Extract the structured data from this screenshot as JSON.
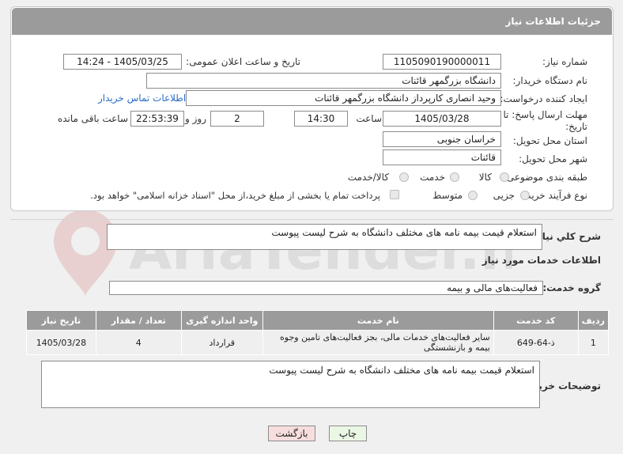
{
  "header": {
    "title": "جزئیات اطلاعات نیاز"
  },
  "form": {
    "need_number_label": "شماره نیاز:",
    "need_number": "1105090190000011",
    "announce_label": "تاریخ و ساعت اعلان عمومی:",
    "announce_value": "1405/03/25 - 14:24",
    "buyer_org_label": "نام دستگاه خریدار:",
    "buyer_org": "دانشگاه بزرگمهر قائنات",
    "creator_label": "ایجاد کننده درخواست:",
    "creator": "وحید انصاری کارپرداز دانشگاه بزرگمهر قائنات",
    "contact_link": "اطلاعات تماس خریدار",
    "deadline_label_1": "مهلت ارسال پاسخ: تا",
    "deadline_label_2": "تاریخ:",
    "deadline_date": "1405/03/28",
    "time_label": "ساعت",
    "deadline_time": "14:30",
    "days_value": "2",
    "days_label": "روز و",
    "remaining_value": "22:53:39",
    "remaining_label": "ساعت باقی مانده",
    "province_label": "استان محل تحویل:",
    "province": "خراسان جنوبی",
    "city_label": "شهر محل تحویل:",
    "city": "قائنات",
    "category_label": "طبقه بندی موضوعی:",
    "category_options": [
      "کالا",
      "خدمت",
      "کالا/خدمت"
    ],
    "process_label": "نوع فرآیند خرید :",
    "process_options": [
      "جزیی",
      "متوسط"
    ],
    "payment_note": "پرداخت تمام یا بخشی از مبلغ خرید،از محل \"اسناد خزانه اسلامی\" خواهد بود."
  },
  "summary": {
    "label": "شرح کلي نياز:",
    "text": "استعلام قیمت بیمه نامه های مختلف دانشگاه به شرح لیست پیوست"
  },
  "services": {
    "section_title": "اطلاعات خدمات مورد نياز",
    "group_label": "گروه خدمت:",
    "group_value": "فعالیت‌های مالی و بیمه",
    "columns": [
      "ردیف",
      "کد خدمت",
      "نام خدمت",
      "واحد اندازه گیری",
      "تعداد / مقدار",
      "تاریخ نیاز"
    ],
    "rows": [
      [
        "1",
        "ذ-64-649",
        "سایر فعالیت‌های خدمات مالی، بجز فعالیت‌های تامین وجوه بیمه و بازنشستگی",
        "قرارداد",
        "4",
        "1405/03/28"
      ]
    ]
  },
  "buyer_notes": {
    "label": "توضیحات خریدار:",
    "text": "استعلام قیمت بیمه نامه های مختلف دانشگاه به شرح لیست پیوست"
  },
  "buttons": {
    "print": "چاپ",
    "back": "بازگشت"
  },
  "watermark": {
    "text": "AriaTender.neT"
  },
  "colors": {
    "header_bg": "#9b9b9b",
    "link": "#2a6dc7",
    "back_button_bg": "#f7dede",
    "print_button_bg": "#eaf7e4"
  }
}
